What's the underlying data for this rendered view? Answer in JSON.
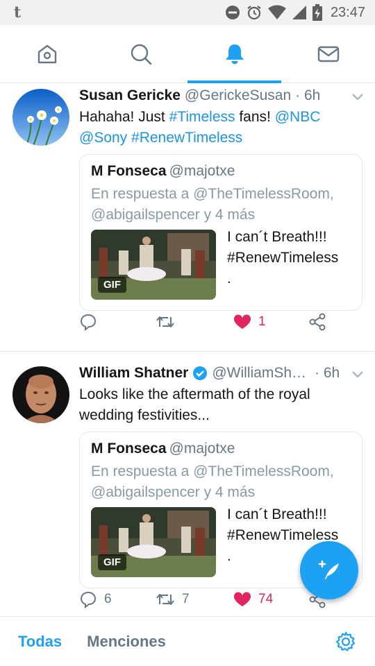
{
  "status_bar": {
    "app_icon": "t",
    "time": "23:47",
    "icons": [
      "do-not-disturb-icon",
      "alarm-icon",
      "wifi-icon",
      "signal-icon",
      "battery-charging-icon"
    ]
  },
  "tabs": [
    {
      "name": "home-icon",
      "active": false
    },
    {
      "name": "search-icon",
      "active": false
    },
    {
      "name": "notifications-bell-icon",
      "active": true
    },
    {
      "name": "messages-icon",
      "active": false
    }
  ],
  "tweets": [
    {
      "name": "Susan Gericke",
      "handle": "@GerickeSusan",
      "time": "· 6h",
      "text_parts": [
        "Hahaha! Just ",
        "#Timeless",
        " fans! ",
        "@NBC",
        " ",
        "@Sony",
        " ",
        "#RenewTimeless"
      ],
      "quote": {
        "name": "M Fonseca",
        "handle": "@majotxe",
        "reply_prefix": "En respuesta a ",
        "reply_user1": "@TheTimelessRoom,",
        "reply_user2": "@abigailspencer",
        "reply_suffix": " y 4 más",
        "gif_label": "GIF",
        "text_line1": "I can´t Breath!!!",
        "text_line2": "#RenewTimeless",
        "text_line3": "."
      },
      "replies": "",
      "retweets": "",
      "likes": "1"
    },
    {
      "name": "William Shatner",
      "handle": "@WilliamSh…",
      "time": "· 6h",
      "verified": true,
      "text_line1": "Looks like the aftermath of the royal",
      "text_line2": "wedding festivities...",
      "quote": {
        "name": "M Fonseca",
        "handle": "@majotxe",
        "reply_prefix": "En respuesta a ",
        "reply_user1": "@TheTimelessRoom,",
        "reply_user2": "@abigailspencer",
        "reply_suffix": " y 4 más",
        "gif_label": "GIF",
        "text_line1": "I can´t Breath!!!",
        "text_line2": "#RenewTimeless",
        "text_line3": "."
      },
      "replies": "6",
      "retweets": "7",
      "likes": "74"
    }
  ],
  "bottom_tabs": {
    "all": "Todas",
    "mentions": "Menciones"
  },
  "colors": {
    "accent": "#1da1f2",
    "like": "#e0245e",
    "muted": "#657786"
  }
}
